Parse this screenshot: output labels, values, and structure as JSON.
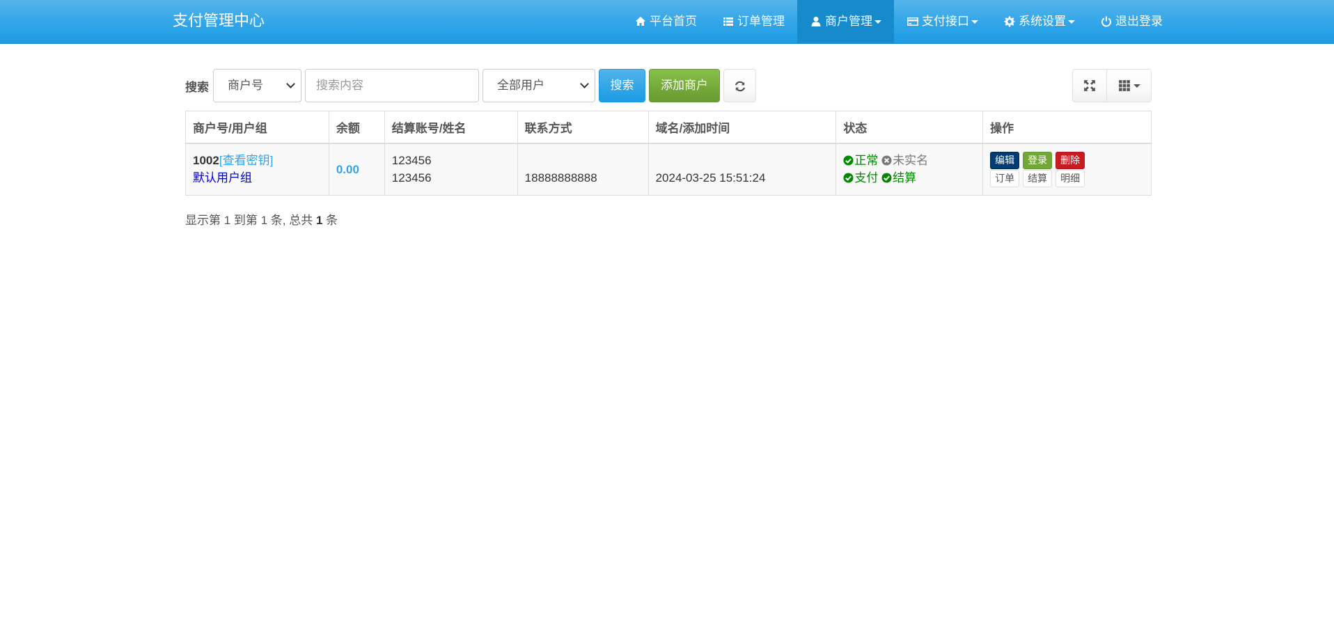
{
  "brand": "支付管理中心",
  "nav": [
    {
      "label": "平台首页",
      "icon": "home-icon"
    },
    {
      "label": "订单管理",
      "icon": "list-icon"
    },
    {
      "label": "商户管理",
      "icon": "user-icon",
      "active": true,
      "dropdown": true
    },
    {
      "label": "支付接口",
      "icon": "credit-card-icon",
      "dropdown": true
    },
    {
      "label": "系统设置",
      "icon": "gear-icon",
      "dropdown": true
    },
    {
      "label": "退出登录",
      "icon": "power-icon"
    }
  ],
  "toolbar": {
    "search_label": "搜索",
    "field_select": "商户号",
    "search_placeholder": "搜索内容",
    "user_filter": "全部用户",
    "search_button": "搜索",
    "add_button": "添加商户"
  },
  "table": {
    "headers": [
      "商户号/用户组",
      "余额",
      "结算账号/姓名",
      "联系方式",
      "域名/添加时间",
      "状态",
      "操作"
    ],
    "rows": [
      {
        "uid": "1002",
        "key_link": "查看密钥",
        "group": "默认用户组",
        "balance": "0.00",
        "account": "123456",
        "name": "123456",
        "contact": "18888888888",
        "added": "2024-03-25 15:51:24",
        "status_normal": "正常",
        "status_realname": "未实名",
        "status_pay": "支付",
        "status_settle": "结算",
        "actions": {
          "edit": "编辑",
          "login": "登录",
          "delete": "删除",
          "orders": "订单",
          "settle": "结算",
          "detail": "明细"
        }
      }
    ]
  },
  "summary": {
    "prefix": "显示第 1 到第 1 条, 总共 ",
    "total": "1",
    "suffix": " 条"
  },
  "colors": {
    "nav_bg": "#2fa4e7",
    "primary": "#2fa4e7",
    "success": "#73a839",
    "danger": "#c71c22",
    "edit": "#033c73",
    "ok_green": "#008800"
  }
}
